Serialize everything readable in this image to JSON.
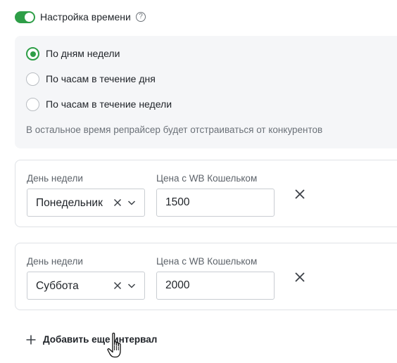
{
  "time_settings": {
    "toggle_on": true,
    "title": "Настройка времени",
    "help_symbol": "?",
    "accent_color": "#2e9e47"
  },
  "schedule_mode": {
    "options": [
      {
        "label": "По дням недели",
        "checked": true
      },
      {
        "label": "По часам в течение дня",
        "checked": false
      },
      {
        "label": "По часам в течение недели",
        "checked": false
      }
    ],
    "note": "В остальное время репрайсер будет отстраиваться от конкурентов"
  },
  "intervals": [
    {
      "day_label": "День недели",
      "day_value": "Понедельник",
      "price_label": "Цена с WB Кошельком",
      "price_value": "1500"
    },
    {
      "day_label": "День недели",
      "day_value": "Суббота",
      "price_label": "Цена с WB Кошельком",
      "price_value": "2000"
    }
  ],
  "add_interval": {
    "label": "Добавить еще интервал",
    "icon": "plus-icon"
  },
  "icons": {
    "clear": "close-icon",
    "dropdown": "chevron-down-icon",
    "remove": "close-icon",
    "help": "help-circle-icon",
    "cursor": "hand-pointer-icon"
  }
}
